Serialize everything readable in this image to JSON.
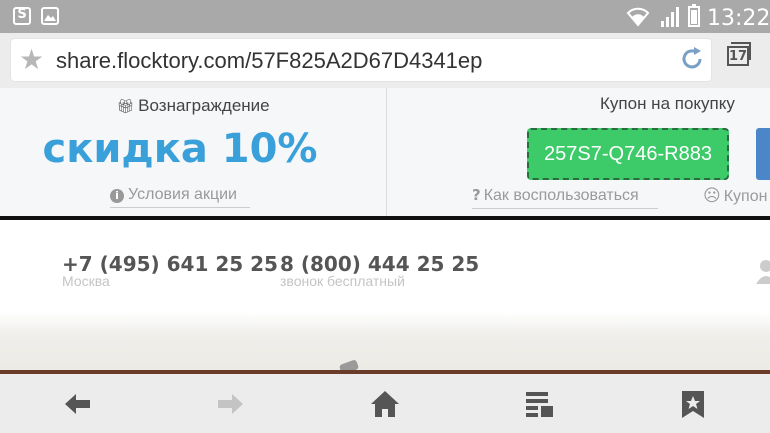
{
  "status_bar": {
    "time": "13:22",
    "left_icons": [
      "skype-notification-icon",
      "image-notification-icon"
    ],
    "right_icons": [
      "wifi-icon",
      "signal-icon",
      "battery-icon"
    ]
  },
  "browser": {
    "url": "share.flocktory.com/57F825A2D67D4341ep",
    "tab_count": "17"
  },
  "coupon_panel": {
    "reward_title": "Вознаграждение",
    "discount": "скидка 10%",
    "terms_link": "Условия акции",
    "coupon_title": "Купон на покупку",
    "coupon_code": "257S7-Q746-R883",
    "howto_link": "Как воспользоваться",
    "coupon_more_link": "Купон",
    "accent_color": "#3aa0da",
    "coupon_color": "#3dcb6a"
  },
  "site": {
    "phones": [
      {
        "number": "+7 (495) 641 25 25",
        "label": "Москва"
      },
      {
        "number": "8 (800) 444 25 25",
        "label": "звонок бесплатный"
      }
    ]
  },
  "bottom_nav": {
    "buttons": [
      "back-icon",
      "forward-icon",
      "home-icon",
      "reader-icon",
      "bookmarks-icon"
    ]
  }
}
